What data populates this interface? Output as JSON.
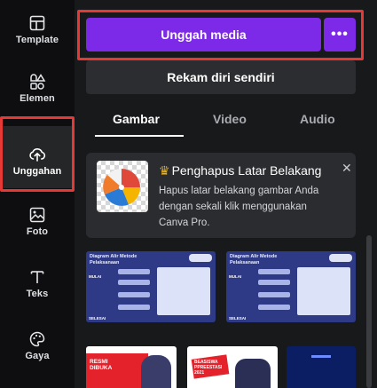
{
  "rail": {
    "items": [
      {
        "label": "Template",
        "icon": "template-icon"
      },
      {
        "label": "Elemen",
        "icon": "elements-icon"
      },
      {
        "label": "Unggahan",
        "icon": "cloud-upload-icon"
      },
      {
        "label": "Foto",
        "icon": "photo-icon"
      },
      {
        "label": "Teks",
        "icon": "text-icon"
      },
      {
        "label": "Gaya",
        "icon": "palette-icon"
      }
    ],
    "active_index": 2
  },
  "upload": {
    "primary_label": "Unggah media",
    "more_label": "•••",
    "record_label": "Rekam diri sendiri"
  },
  "tabs": [
    {
      "label": "Gambar",
      "active": true
    },
    {
      "label": "Video",
      "active": false
    },
    {
      "label": "Audio",
      "active": false
    }
  ],
  "promo": {
    "title": "Penghapus Latar Belakang",
    "description": "Hapus latar belakang gambar Anda dengan sekali klik menggunakan Canva Pro.",
    "close_label": "✕",
    "crown_icon": "crown-icon"
  },
  "thumbnails": [
    {
      "title": "Diagram Alir Metode Pelaksanaan",
      "left_label": "MULAI",
      "bottom_label": "SELESAI"
    },
    {
      "title": "Diagram Alir Metode Pelaksanaan",
      "left_label": "MULAI",
      "bottom_label": "SELESAI"
    },
    {
      "banner": "RESMI DIBUKA"
    },
    {
      "banner": "BEASISWA PPREESTASI 2021"
    },
    {
      "banner": ""
    }
  ],
  "colors": {
    "accent": "#7d2ae8",
    "annotation": "#e53935",
    "rail_bg": "#0e0e10",
    "panel_bg": "#18191b"
  }
}
